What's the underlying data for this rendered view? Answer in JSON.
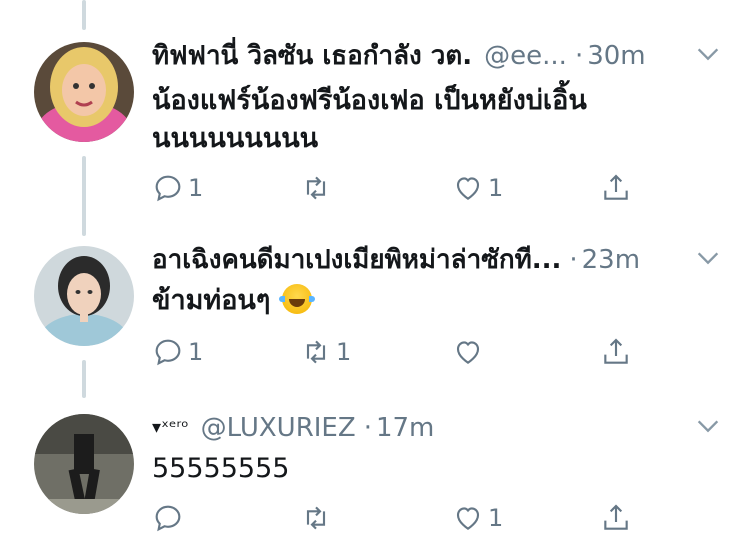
{
  "tweets": [
    {
      "name": "ทิฟฟานี่ วิลซัน เธอกำลัง วต.",
      "handle": "@ee...",
      "time": "30m",
      "text_lines": [
        "น้องแฟร์น้องฟรีน้องเฟอ เป็นหยังบ่เอิ้น",
        "นนนนนนนนน"
      ],
      "reply_count": "1",
      "retweet_count": "",
      "like_count": "1"
    },
    {
      "name": "อาเฉิงคนดีมาเปงเมียพิหม่าล่าซักที...",
      "handle": "",
      "time": "23m",
      "text_lines": [
        "ข้ามท่อนๆ"
      ],
      "reply_count": "1",
      "retweet_count": "1",
      "like_count": ""
    },
    {
      "name": "▾ˣᵉʳᵒ",
      "handle": "@LUXURIEZ",
      "time": "17m",
      "text_lines": [
        "55555555"
      ],
      "reply_count": "",
      "retweet_count": "",
      "like_count": "1"
    }
  ],
  "icons": {
    "reply": "reply-icon",
    "retweet": "retweet-icon",
    "like": "heart-icon",
    "share": "share-icon",
    "menu": "chevron-down-icon",
    "emoji": "face-with-tears-of-joy-emoji"
  },
  "colors": {
    "text": "#14171a",
    "secondary": "#657786",
    "thread_line": "#cfd9de"
  }
}
